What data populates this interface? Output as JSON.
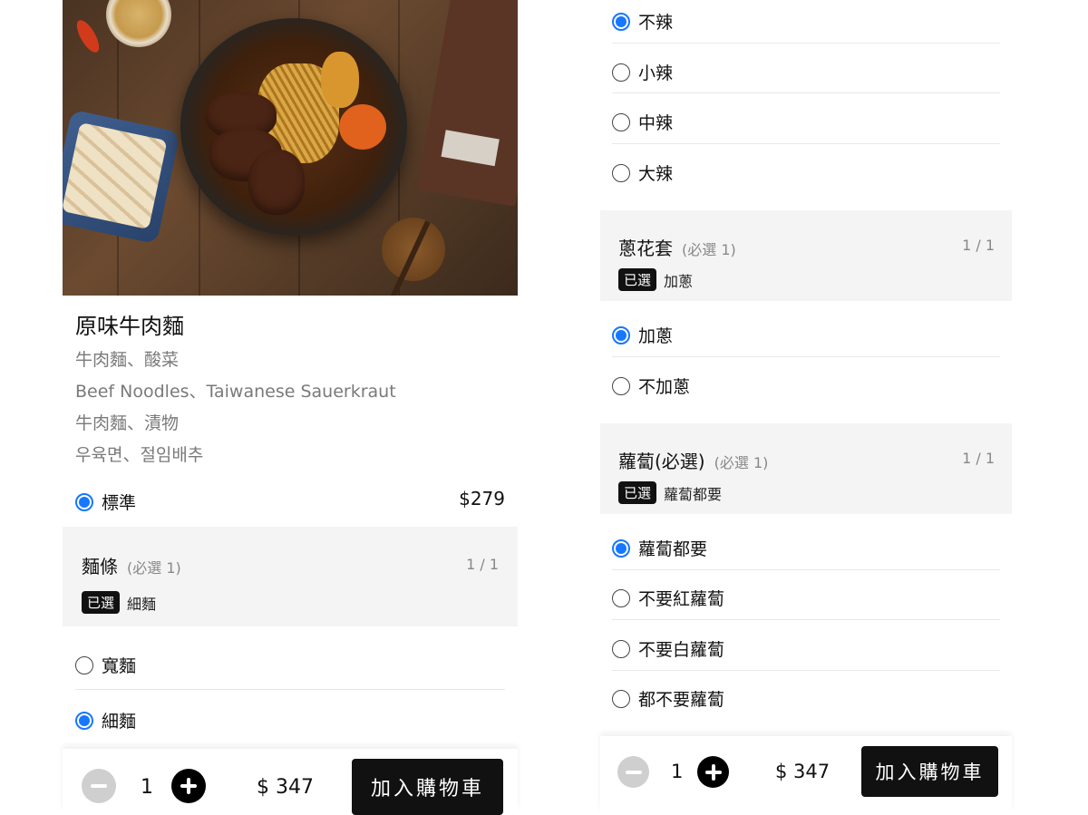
{
  "product": {
    "title": "原味牛肉麵",
    "desc_zh": "牛肉麵、酸菜",
    "desc_en": "Beef Noodles、Taiwanese Sauerkraut",
    "desc_ja": "牛肉麵、漬物",
    "desc_ko": "우육면、절임배추",
    "size_option": "標準",
    "price": "$279"
  },
  "noodle_section": {
    "title": "麵條",
    "required": "(必選 1)",
    "count": "1 / 1",
    "chosen_badge": "已選",
    "chosen_value": "細麵",
    "options": [
      {
        "label": "寬麵",
        "selected": false
      },
      {
        "label": "細麵",
        "selected": true
      }
    ]
  },
  "spicy_options": [
    {
      "label": "不辣",
      "selected": true
    },
    {
      "label": "小辣",
      "selected": false
    },
    {
      "label": "中辣",
      "selected": false
    },
    {
      "label": "大辣",
      "selected": false
    }
  ],
  "scallion_section": {
    "title": "蔥花套",
    "required": "(必選 1)",
    "count": "1 / 1",
    "chosen_badge": "已選",
    "chosen_value": "加蔥",
    "options": [
      {
        "label": "加蔥",
        "selected": true
      },
      {
        "label": "不加蔥",
        "selected": false
      }
    ]
  },
  "radish_section": {
    "title": "蘿蔔(必選)",
    "required": "(必選 1)",
    "count": "1 / 1",
    "chosen_badge": "已選",
    "chosen_value": "蘿蔔都要",
    "options": [
      {
        "label": "蘿蔔都要",
        "selected": true
      },
      {
        "label": "不要紅蘿蔔",
        "selected": false
      },
      {
        "label": "不要白蘿蔔",
        "selected": false
      },
      {
        "label": "都不要蘿蔔",
        "selected": false
      }
    ]
  },
  "footer_left": {
    "quantity": "1",
    "total": "$ 347",
    "cart_label": "加入購物車"
  },
  "footer_right": {
    "quantity": "1",
    "total": "$ 347",
    "cart_label": "加入購物車"
  },
  "colors": {
    "accent": "#1677ff",
    "section_bg": "#f4f4f4",
    "button_bg": "#111111"
  }
}
